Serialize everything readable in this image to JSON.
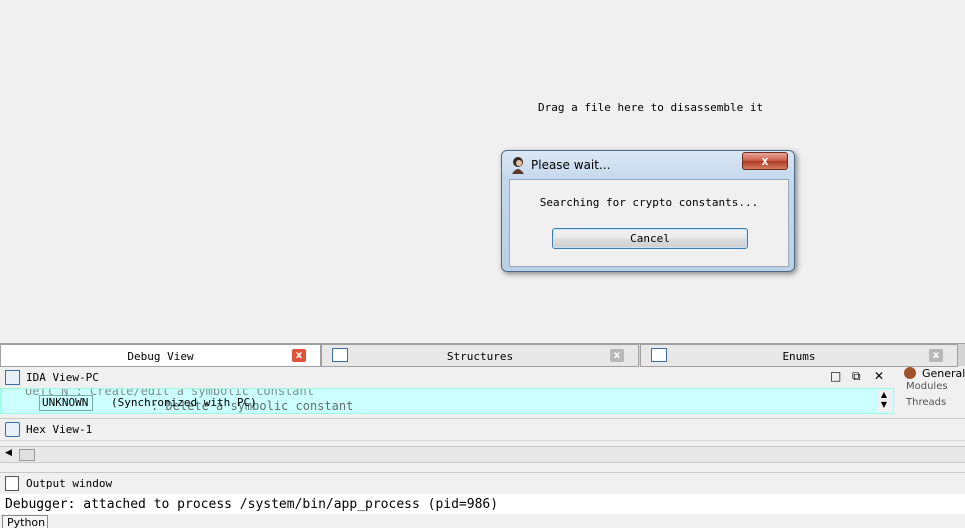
{
  "workspace": {
    "drop_hint": "Drag a file here to disassemble it"
  },
  "dialog": {
    "title": "Please wait...",
    "close_label": "x",
    "message": "Searching for crypto constants...",
    "cancel_label": "Cancel"
  },
  "tabs": [
    {
      "label": "Debug View",
      "close": "x"
    },
    {
      "label": "Structures",
      "close": "x"
    },
    {
      "label": "Enums",
      "close": "x"
    }
  ],
  "ida_view": {
    "title": "IDA View-PC",
    "controls": [
      "□",
      "⧉",
      "✕"
    ],
    "ghost_line_1": "Uefl N      : Create/edit a symbolic constant",
    "ghost_line_2": ": Delete a symbolic constant",
    "segment": "UNKNOWN",
    "sync_text": "(Synchronized with PC)"
  },
  "general_panel": {
    "title": "General",
    "item_1": "Modules",
    "item_2": "Threads"
  },
  "hex_view": {
    "title": "Hex View-1"
  },
  "output_window": {
    "title": "Output window",
    "line": "Debugger: attached to process /system/bin/app_process (pid=986)"
  },
  "python_button": "Python"
}
